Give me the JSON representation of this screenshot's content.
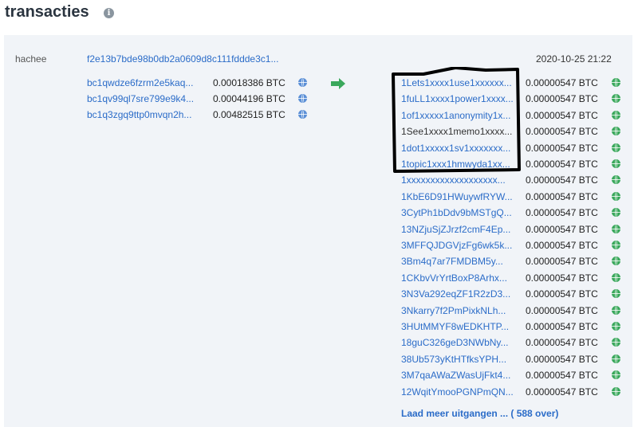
{
  "header": {
    "title": "transacties",
    "info_icon": "info-icon"
  },
  "tx": {
    "label": "hachee",
    "txid": "f2e13b7bde98b0db2a0609d8c111fddde3c1...",
    "time": "2020-10-25 21:22"
  },
  "inputs": [
    {
      "address": "bc1qwdze6fzrm2e5kaq...",
      "amount": "0.00018386 BTC"
    },
    {
      "address": "bc1qv99ql7sre799e9k4...",
      "amount": "0.00044196 BTC"
    },
    {
      "address": "bc1q3zgq9ttp0mvqn2h...",
      "amount": "0.00482515 BTC"
    }
  ],
  "outputs": [
    {
      "address": "1Lets1xxxx1use1xxxxxx...",
      "amount": "0.00000547 BTC",
      "linked": true
    },
    {
      "address": "1fuLL1xxxx1power1xxxx...",
      "amount": "0.00000547 BTC",
      "linked": true
    },
    {
      "address": "1of1xxxxx1anonymity1x...",
      "amount": "0.00000547 BTC",
      "linked": true
    },
    {
      "address": "1See1xxxx1memo1xxxx...",
      "amount": "0.00000547 BTC",
      "linked": false
    },
    {
      "address": "1dot1xxxxx1sv1xxxxxxx...",
      "amount": "0.00000547 BTC",
      "linked": true
    },
    {
      "address": "1topic1xxx1hmwyda1xx...",
      "amount": "0.00000547 BTC",
      "linked": true
    },
    {
      "address": "1xxxxxxxxxxxxxxxxxxx...",
      "amount": "0.00000547 BTC",
      "linked": true
    },
    {
      "address": "1KbE6D91HWuywfRYW...",
      "amount": "0.00000547 BTC",
      "linked": true
    },
    {
      "address": "3CytPh1bDdv9bMSTgQ...",
      "amount": "0.00000547 BTC",
      "linked": true
    },
    {
      "address": "13NZjuSjZJrzf2cmF4Ep...",
      "amount": "0.00000547 BTC",
      "linked": true
    },
    {
      "address": "3MFFQJDGVjzFg6wk5k...",
      "amount": "0.00000547 BTC",
      "linked": true
    },
    {
      "address": "3Bm4q7ar7FMDBM5y...",
      "amount": "0.00000547 BTC",
      "linked": true
    },
    {
      "address": "1CKbvVrYrtBoxP8Arhx...",
      "amount": "0.00000547 BTC",
      "linked": true
    },
    {
      "address": "3N3Va292eqZF1R2zD3...",
      "amount": "0.00000547 BTC",
      "linked": true
    },
    {
      "address": "3Nkarry7f2PmPixkNLh...",
      "amount": "0.00000547 BTC",
      "linked": true
    },
    {
      "address": "3HUtMMYF8wEDKHTP...",
      "amount": "0.00000547 BTC",
      "linked": true
    },
    {
      "address": "18guC326geD3NWbNy...",
      "amount": "0.00000547 BTC",
      "linked": true
    },
    {
      "address": "38Ub573yKtHTfksYPH...",
      "amount": "0.00000547 BTC",
      "linked": true
    },
    {
      "address": "3M7qaAWaZWasUjFkt4...",
      "amount": "0.00000547 BTC",
      "linked": true
    },
    {
      "address": "12WqitYmooPGNPmQN...",
      "amount": "0.00000547 BTC",
      "linked": true
    }
  ],
  "load_more": "Laad meer uitgangen ... ( 588 over)",
  "colors": {
    "link": "#2b6cc8",
    "arrow": "#3aa85c",
    "panel": "#f1f4f8"
  }
}
